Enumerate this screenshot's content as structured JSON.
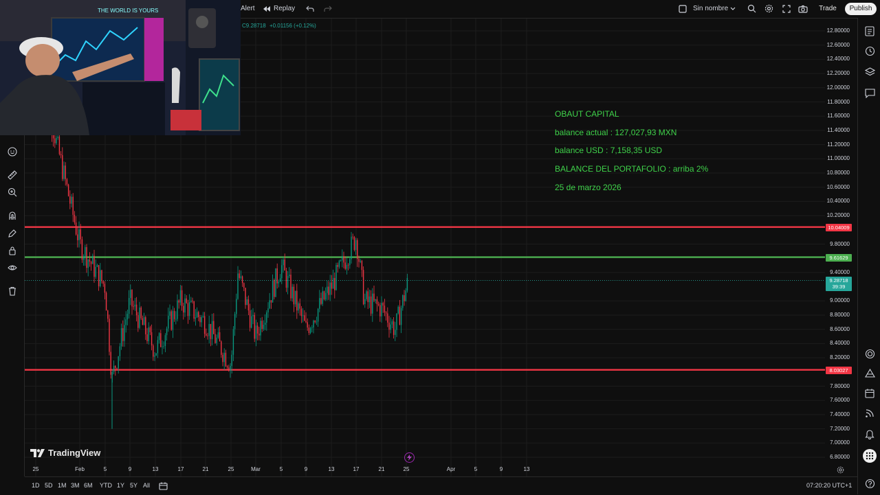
{
  "topbar": {
    "alert_label": "Alert",
    "replay_label": "Replay",
    "layout_name": "Sin nombre",
    "trade_label": "Trade",
    "publish_label": "Publish"
  },
  "symbol_bar": {
    "close": "C9.28718",
    "change": "+0.01156 (+0.12%)"
  },
  "overlay_text": {
    "line1": "OBAUT CAPITAL",
    "line2": "balance actual : 127,027,93 MXN",
    "line3": "balance USD : 7,158,35 USD",
    "line4": "BALANCE DEL PORTAFOLIO :  arriba 2%",
    "line5": "25 de marzo 2026"
  },
  "webcam": {
    "monitor_text": "THE WORLD IS YOURS"
  },
  "price_scale": {
    "ticks": [
      "12.80000",
      "12.60000",
      "12.40000",
      "12.20000",
      "12.00000",
      "11.80000",
      "11.60000",
      "11.40000",
      "11.20000",
      "11.00000",
      "10.80000",
      "10.60000",
      "10.40000",
      "10.20000",
      "9.80000",
      "9.40000",
      "9.00000",
      "8.80000",
      "8.60000",
      "8.40000",
      "8.20000",
      "7.80000",
      "7.60000",
      "7.40000",
      "7.20000",
      "7.00000",
      "6.80000"
    ],
    "labels": {
      "upper_red": "10.04009",
      "green": "9.61629",
      "current": "9.28718",
      "countdown": "39:39",
      "lower_red": "8.03027"
    }
  },
  "time_axis": {
    "labels": [
      "25",
      "Feb",
      "5",
      "9",
      "13",
      "17",
      "21",
      "25",
      "Mar",
      "5",
      "9",
      "13",
      "17",
      "21",
      "25",
      "Apr",
      "5",
      "9",
      "13"
    ]
  },
  "bottombar": {
    "ranges": [
      "1D",
      "5D",
      "1M",
      "3M",
      "6M",
      "YTD",
      "1Y",
      "5Y",
      "All"
    ],
    "clock": "07:20:20 UTC+1"
  },
  "brand": "TradingView",
  "colors": {
    "red_line": "#f23645",
    "green_line": "#4caf50",
    "up_candle": "#089981",
    "down_candle": "#f23645",
    "overlay_text": "#3fd24a",
    "current_price": "#26a69a"
  },
  "chart_data": {
    "type": "candlestick",
    "horizontal_lines": [
      {
        "value": 10.04009,
        "color": "red"
      },
      {
        "value": 9.61629,
        "color": "green"
      },
      {
        "value": 8.03027,
        "color": "red"
      }
    ],
    "current_price": 9.28718,
    "ylim": [
      6.7,
      12.9
    ],
    "price_path": [
      {
        "x": "25",
        "y": 12.5
      },
      {
        "x": "Feb",
        "y": 9.8
      },
      {
        "x": "5",
        "y": 9.2
      },
      {
        "x": "7",
        "y": 7.9
      },
      {
        "x": "9",
        "y": 9.0
      },
      {
        "x": "13",
        "y": 8.3
      },
      {
        "x": "17",
        "y": 9.0
      },
      {
        "x": "21",
        "y": 8.7
      },
      {
        "x": "25",
        "y": 8.1
      },
      {
        "x": "27",
        "y": 9.4
      },
      {
        "x": "Mar",
        "y": 8.5
      },
      {
        "x": "5",
        "y": 9.5
      },
      {
        "x": "9",
        "y": 8.6
      },
      {
        "x": "13",
        "y": 9.2
      },
      {
        "x": "17",
        "y": 9.9
      },
      {
        "x": "19",
        "y": 9.0
      },
      {
        "x": "21",
        "y": 8.9
      },
      {
        "x": "23",
        "y": 8.6
      },
      {
        "x": "25",
        "y": 9.28718
      }
    ]
  }
}
